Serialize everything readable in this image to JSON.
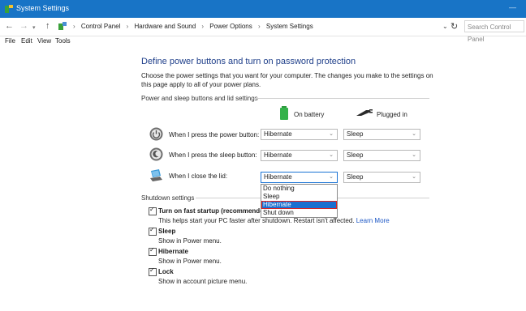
{
  "window": {
    "title": "System Settings",
    "minimize": "—"
  },
  "address": {
    "crumbs": [
      "Control Panel",
      "Hardware and Sound",
      "Power Options",
      "System Settings"
    ],
    "search_placeholder": "Search Control Panel"
  },
  "menu": [
    "File",
    "Edit",
    "View",
    "Tools"
  ],
  "page": {
    "heading": "Define power buttons and turn on password protection",
    "intro": "Choose the power settings that you want for your computer. The changes you make to the settings on this page apply to all of your power plans."
  },
  "power_section": {
    "title": "Power and sleep buttons and lid settings",
    "col_battery": "On battery",
    "col_plugged": "Plugged in",
    "rows": [
      {
        "label": "When I press the power button:",
        "battery": "Hibernate",
        "plugged": "Sleep"
      },
      {
        "label": "When I press the sleep button:",
        "battery": "Hibernate",
        "plugged": "Sleep"
      },
      {
        "label": "When I close the lid:",
        "battery": "Hibernate",
        "plugged": "Sleep"
      }
    ],
    "dropdown_options": [
      "Do nothing",
      "Sleep",
      "Hibernate",
      "Shut down"
    ],
    "dropdown_selected": "Hibernate"
  },
  "shutdown_section": {
    "title": "Shutdown settings",
    "items": [
      {
        "label": "Turn on fast startup (recommended)",
        "desc": "This helps start your PC faster after shutdown. Restart isn't affected.",
        "link": "Learn More",
        "checked": true
      },
      {
        "label": "Sleep",
        "desc": "Show in Power menu.",
        "checked": true
      },
      {
        "label": "Hibernate",
        "desc": "Show in Power menu.",
        "checked": true
      },
      {
        "label": "Lock",
        "desc": "Show in account picture menu.",
        "checked": true
      }
    ]
  },
  "colors": {
    "titlebar": "#1874c6",
    "heading": "#1f3f8a",
    "highlight": "#1a6fd0",
    "link": "#1a55c4"
  }
}
